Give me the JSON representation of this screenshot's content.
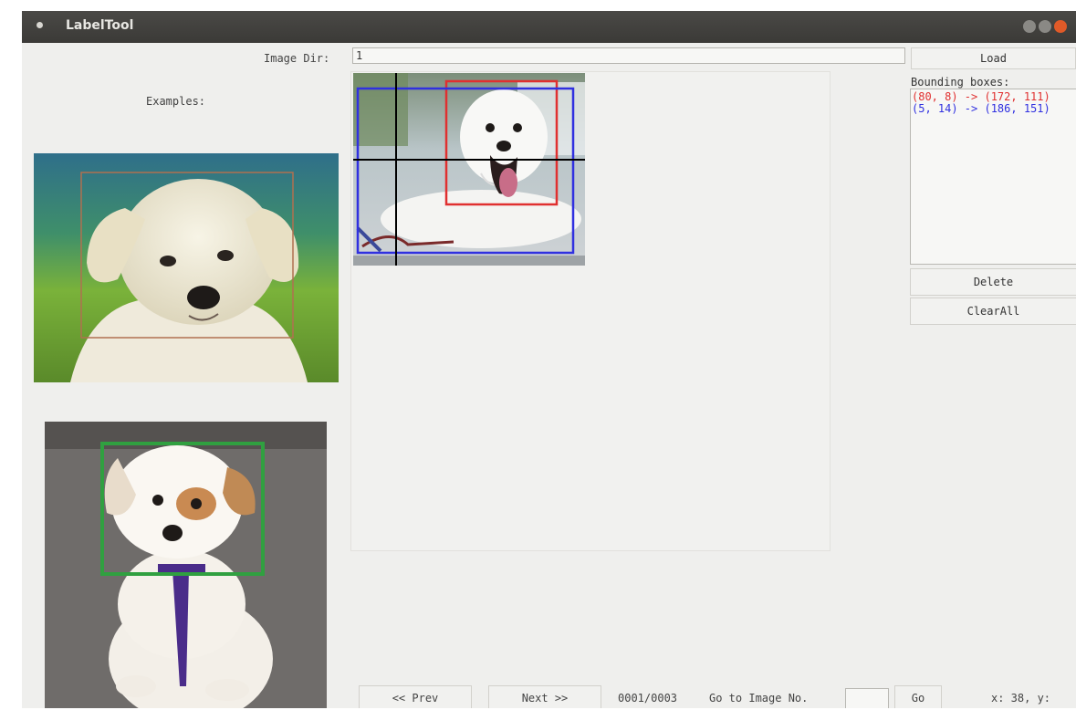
{
  "window": {
    "title": "LabelTool"
  },
  "image_dir": {
    "label": "Image Dir:",
    "value": "1"
  },
  "load_button": "Load",
  "examples_label": "Examples:",
  "bounding_boxes": {
    "label": "Bounding boxes:",
    "items": [
      {
        "text": "(80, 8) -> (172, 111)",
        "color": "#e03030"
      },
      {
        "text": "(5, 14) -> (186, 151)",
        "color": "#3030e0"
      }
    ]
  },
  "delete_button": "Delete",
  "clearall_button": "ClearAll",
  "navigation": {
    "prev_label": "<< Prev",
    "next_label": "Next >>",
    "progress": "0001/0003",
    "goto_label": "Go to Image No.",
    "goto_value": "",
    "go_label": "Go",
    "coords": "x: 38, y:"
  },
  "colors": {
    "titlebar": "#3b3a37",
    "close_button": "#e05a28",
    "box_red": "#e03030",
    "box_blue": "#3030e0",
    "example_box_brown": "#b07050",
    "example_box_green": "#30a040"
  }
}
